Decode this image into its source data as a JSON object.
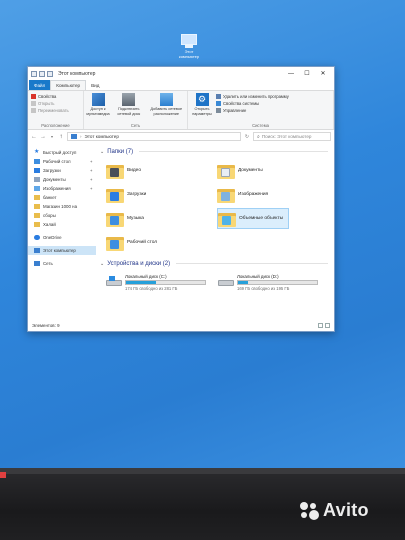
{
  "desktop": {
    "icon_label": "Этот компьютер"
  },
  "window": {
    "title": "Этот компьютер",
    "controls": {
      "minimize": "—",
      "maximize": "☐",
      "close": "✕"
    }
  },
  "ribbon_tabs": [
    "Файл",
    "Компьютер",
    "Вид"
  ],
  "ribbon": {
    "groups": [
      {
        "label": "Расположение",
        "small": [
          "Свойства",
          "Открыть",
          "Переименовать"
        ]
      },
      {
        "label": "Сеть",
        "big": [
          "Доступ к мультимедиа",
          "Подключить сетевой диск",
          "Добавить сетевое расположение"
        ]
      },
      {
        "label": "Система",
        "big": [
          "Открыть параметры"
        ],
        "small": [
          "Удалить или изменить программу",
          "Свойства системы",
          "Управление"
        ]
      }
    ]
  },
  "address": {
    "path": "Этот компьютер",
    "search_placeholder": "Поиск: Этот компьютер"
  },
  "nav_pane": {
    "quick_access": "Быстрый доступ",
    "pinned": [
      "Рабочий стол",
      "Загрузки",
      "Документы",
      "Изображения"
    ],
    "folders": [
      "банкет",
      "Магазин 1000 на",
      "сборы",
      "Халай"
    ],
    "onedrive": "OneDrive",
    "this_pc": "Этот компьютер",
    "network": "Сеть"
  },
  "folders_section": {
    "header": "Папки (7)",
    "items": [
      "Видео",
      "Документы",
      "Загрузки",
      "Изображения",
      "Музыка",
      "Объемные объекты",
      "Рабочий стол"
    ]
  },
  "drives_section": {
    "header": "Устройства и диски (2)",
    "drives": [
      {
        "name": "Локальный диск (C:)",
        "free_text": "174 ГБ свободно из 281 ГБ",
        "used_fraction": 0.38
      },
      {
        "name": "Локальный диск (D:)",
        "free_text": "169 ГБ свободно из 195 ГБ",
        "used_fraction": 0.13
      }
    ]
  },
  "status": {
    "items_count": "Элементов: 9"
  },
  "watermark": "Avito"
}
